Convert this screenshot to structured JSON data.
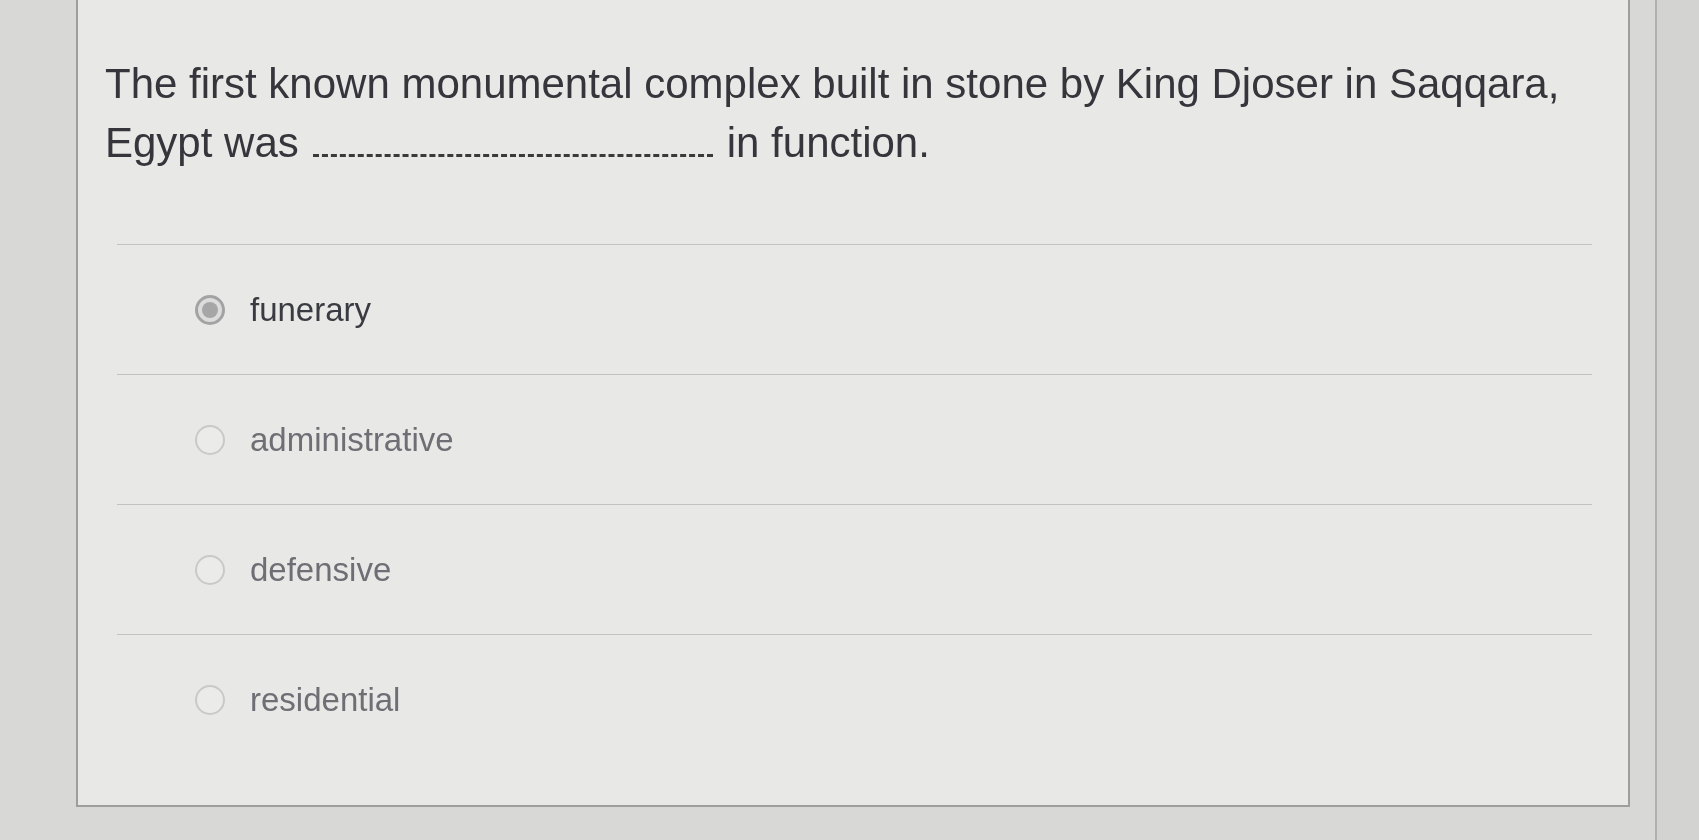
{
  "question": {
    "text_before": "The first known monumental complex built in stone by King Djoser in Saqqara, Egypt was",
    "text_after": "in function."
  },
  "options": [
    {
      "label": "funerary",
      "selected": true
    },
    {
      "label": "administrative",
      "selected": false
    },
    {
      "label": "defensive",
      "selected": false
    },
    {
      "label": "residential",
      "selected": false
    }
  ]
}
